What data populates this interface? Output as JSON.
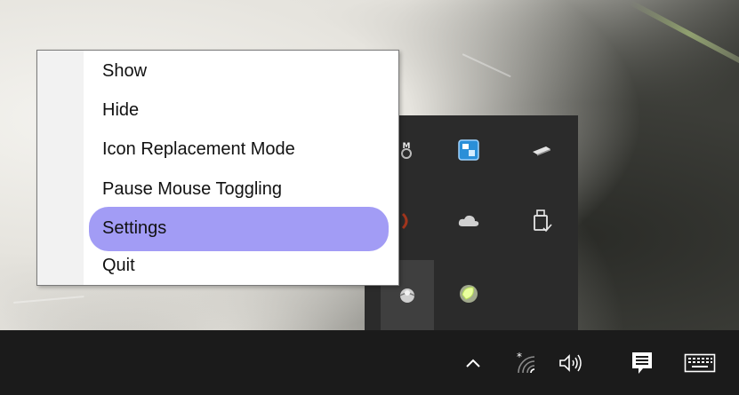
{
  "context_menu": {
    "items": [
      {
        "label": "Show"
      },
      {
        "label": "Hide"
      },
      {
        "label": "Icon Replacement Mode"
      },
      {
        "label": "Pause Mouse Toggling"
      },
      {
        "label": "Settings",
        "selected": true
      },
      {
        "label": "Quit"
      }
    ],
    "highlight_color": "#a29cf5"
  },
  "tray_flyout": {
    "icons": [
      "memory-monitor-icon",
      "network-drive-app-icon",
      "usb-stick-icon",
      "red-status-icon",
      "onedrive-cloud-icon",
      "safely-remove-usb-icon",
      "app-globe-icon",
      "green-leaf-icon"
    ]
  },
  "taskbar": {
    "icons": [
      "chevron-up-icon",
      "wifi-icon",
      "volume-icon",
      "action-center-icon",
      "touch-keyboard-icon"
    ],
    "background": "#1b1b1b"
  }
}
